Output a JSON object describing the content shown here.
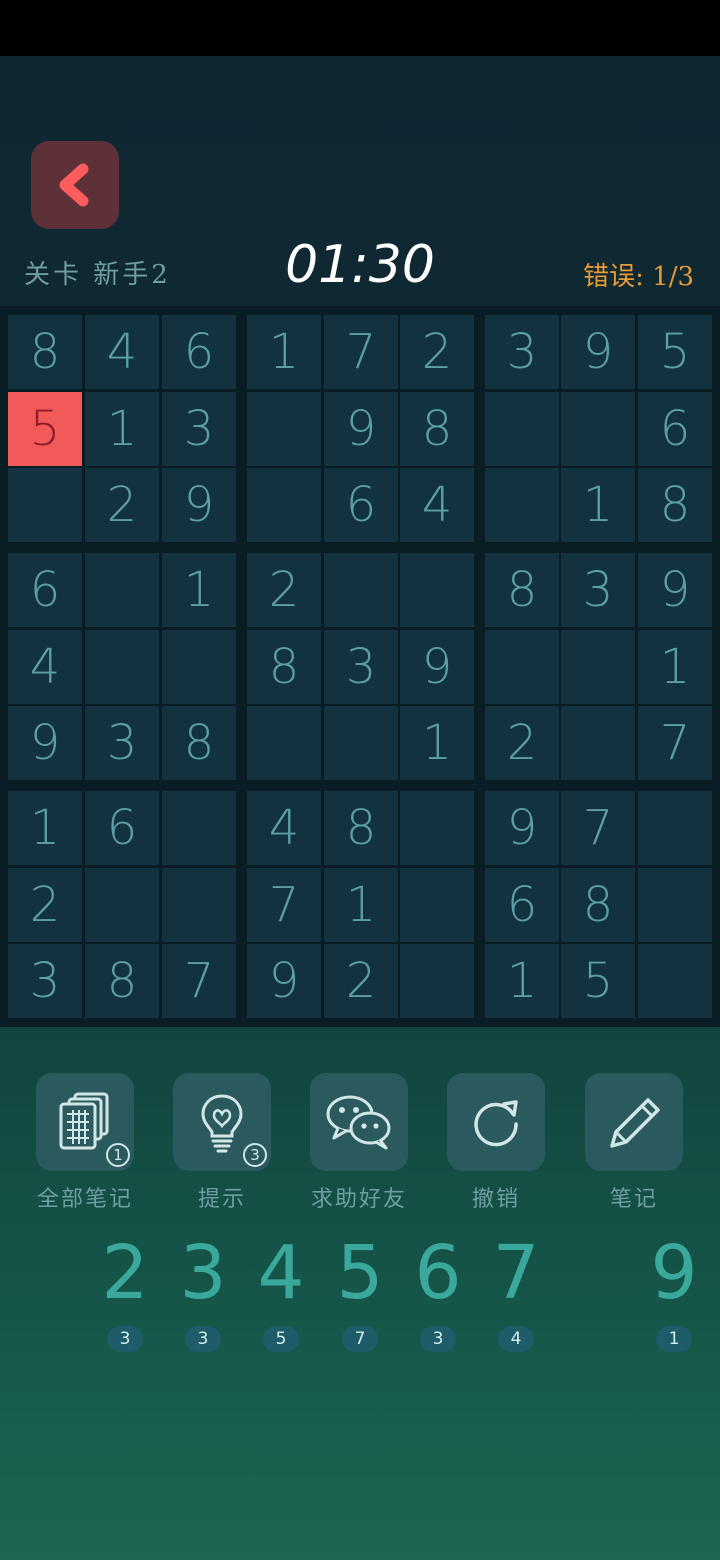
{
  "header": {
    "level_label": "关卡 新手2",
    "timer": "01:30",
    "errors_label": "错误: 1/3"
  },
  "board": {
    "rows": [
      [
        "8",
        "4",
        "6",
        "1",
        "7",
        "2",
        "3",
        "9",
        "5"
      ],
      [
        "5",
        "1",
        "3",
        "",
        "9",
        "8",
        "",
        "",
        "6"
      ],
      [
        "",
        "2",
        "9",
        "",
        "6",
        "4",
        "",
        "1",
        "8"
      ],
      [
        "6",
        "",
        "1",
        "2",
        "",
        "",
        "8",
        "3",
        "9"
      ],
      [
        "4",
        "",
        "",
        "8",
        "3",
        "9",
        "",
        "",
        "1"
      ],
      [
        "9",
        "3",
        "8",
        "",
        "",
        "1",
        "2",
        "",
        "7"
      ],
      [
        "1",
        "6",
        "",
        "4",
        "8",
        "",
        "9",
        "7",
        ""
      ],
      [
        "2",
        "",
        "",
        "7",
        "1",
        "",
        "6",
        "8",
        ""
      ],
      [
        "3",
        "8",
        "7",
        "9",
        "2",
        "",
        "1",
        "5",
        ""
      ]
    ],
    "error_cell": {
      "row": 1,
      "col": 0
    }
  },
  "tools": [
    {
      "name": "all-notes",
      "label": "全部笔记",
      "icon": "notes-grid-icon",
      "badge": "1"
    },
    {
      "name": "hint",
      "label": "提示",
      "icon": "lightbulb-icon",
      "badge": "3"
    },
    {
      "name": "ask-friend",
      "label": "求助好友",
      "icon": "wechat-icon",
      "badge": ""
    },
    {
      "name": "undo",
      "label": "撤销",
      "icon": "undo-icon",
      "badge": ""
    },
    {
      "name": "note",
      "label": "笔记",
      "icon": "pencil-icon",
      "badge": ""
    }
  ],
  "numpad": [
    {
      "digit": "2",
      "count": "3"
    },
    {
      "digit": "3",
      "count": "3"
    },
    {
      "digit": "4",
      "count": "5"
    },
    {
      "digit": "5",
      "count": "7"
    },
    {
      "digit": "6",
      "count": "3"
    },
    {
      "digit": "7",
      "count": "4"
    },
    {
      "digit": "9",
      "count": "1"
    }
  ],
  "colors": {
    "accent": "#3aa89a",
    "error": "#f25a5a",
    "errors_text": "#e69a38",
    "back_button": "#5e3138"
  }
}
